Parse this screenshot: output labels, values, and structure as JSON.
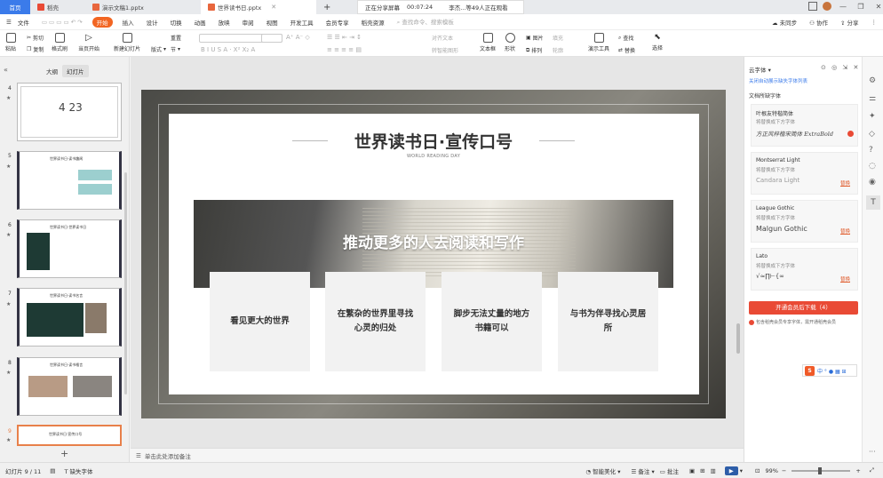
{
  "titlebar": {
    "home": "首页",
    "tabs": [
      {
        "label": "稻壳",
        "color": "#e94a35"
      },
      {
        "label": "演示文稿1.pptx",
        "color": "#e8663d"
      },
      {
        "label": "世界读书日.pptx",
        "color": "#e8663d"
      }
    ],
    "add_tab": "+",
    "share_status": "正在分享屏幕",
    "share_time": "00:07:24",
    "viewers": "李杰...等49人正在观看"
  },
  "menubar": {
    "file": "文件",
    "items": [
      "开始",
      "插入",
      "设计",
      "切换",
      "动画",
      "放映",
      "审阅",
      "视图",
      "开发工具",
      "会员专享",
      "稻壳资源"
    ],
    "search_placeholder": "查找命令、搜索模板",
    "sync": "未同步",
    "collab": "协作",
    "share": "分享"
  },
  "ribbon": {
    "paste": "粘贴",
    "cut": "剪切",
    "copy": "复制",
    "format_painter": "格式刷",
    "from_current": "当页开始",
    "new_slide": "新建幻灯片",
    "layout": "版式",
    "section": "节",
    "reset": "重置",
    "convert_art": "转智能图形",
    "textbox": "文本框",
    "shape": "形状",
    "image": "图片",
    "arrange": "排列",
    "fill": "填充",
    "outline": "轮廓",
    "presenter_tool": "演示工具",
    "find": "查找",
    "replace": "替换",
    "select": "选择",
    "align_text": "对齐文本"
  },
  "leftpanel": {
    "tab_outline": "大纲",
    "tab_slides": "幻灯片",
    "slides": [
      {
        "num": "4",
        "title": "4 23"
      },
      {
        "num": "5",
        "title": "世界读书日·读书趣闻"
      },
      {
        "num": "6",
        "title": "世界读书日·世界读书日"
      },
      {
        "num": "7",
        "title": "世界读书日·读书名言"
      },
      {
        "num": "8",
        "title": "世界读书日·读书格言"
      },
      {
        "num": "9",
        "title": "世界读书日·宣传口号"
      }
    ],
    "add": "+"
  },
  "slide": {
    "title": "世界读书日·宣传口号",
    "subtitle": "WORLD READING DAY",
    "banner": "推动更多的人去阅读和写作",
    "cards": [
      "看见更大的世界",
      "在繁杂的世界里寻找心灵的归处",
      "脚步无法丈量的地方书籍可以",
      "与书为伴寻找心灵居所"
    ]
  },
  "notes": "单击此处添加备注",
  "rightpanel": {
    "title": "云字体",
    "auto_link": "关闭自动展示缺失字体列表",
    "section": "文档所缺字体",
    "fonts": [
      {
        "name": "叶根友特楷简体",
        "sub": "将替换成下方字体",
        "preview": "方正风梓楷宋简体 ExtraBold",
        "link": ""
      },
      {
        "name": "Montserrat Light",
        "sub": "将替换成下方字体",
        "preview": "Candara Light",
        "link": "替换"
      },
      {
        "name": "League Gothic",
        "sub": "将替换成下方字体",
        "preview": "Malgun Gothic",
        "link": "替换"
      },
      {
        "name": "Lato",
        "sub": "将替换成下方字体",
        "preview": "√≈∏⊢{∞",
        "link": "替换"
      }
    ],
    "download_button": "开通会员后下载（4）",
    "note": "包含稻壳会员专享字体，需开通稻壳会员"
  },
  "statusbar": {
    "slide_count": "幻灯片 9 / 11",
    "missing_font": "缺失字体",
    "beautify": "智能美化",
    "notes": "备注",
    "comments": "批注",
    "zoom": "99%"
  },
  "colors": {
    "accent": "#f26522",
    "home_tab": "#3b7bea",
    "download_button": "#e94a35"
  }
}
